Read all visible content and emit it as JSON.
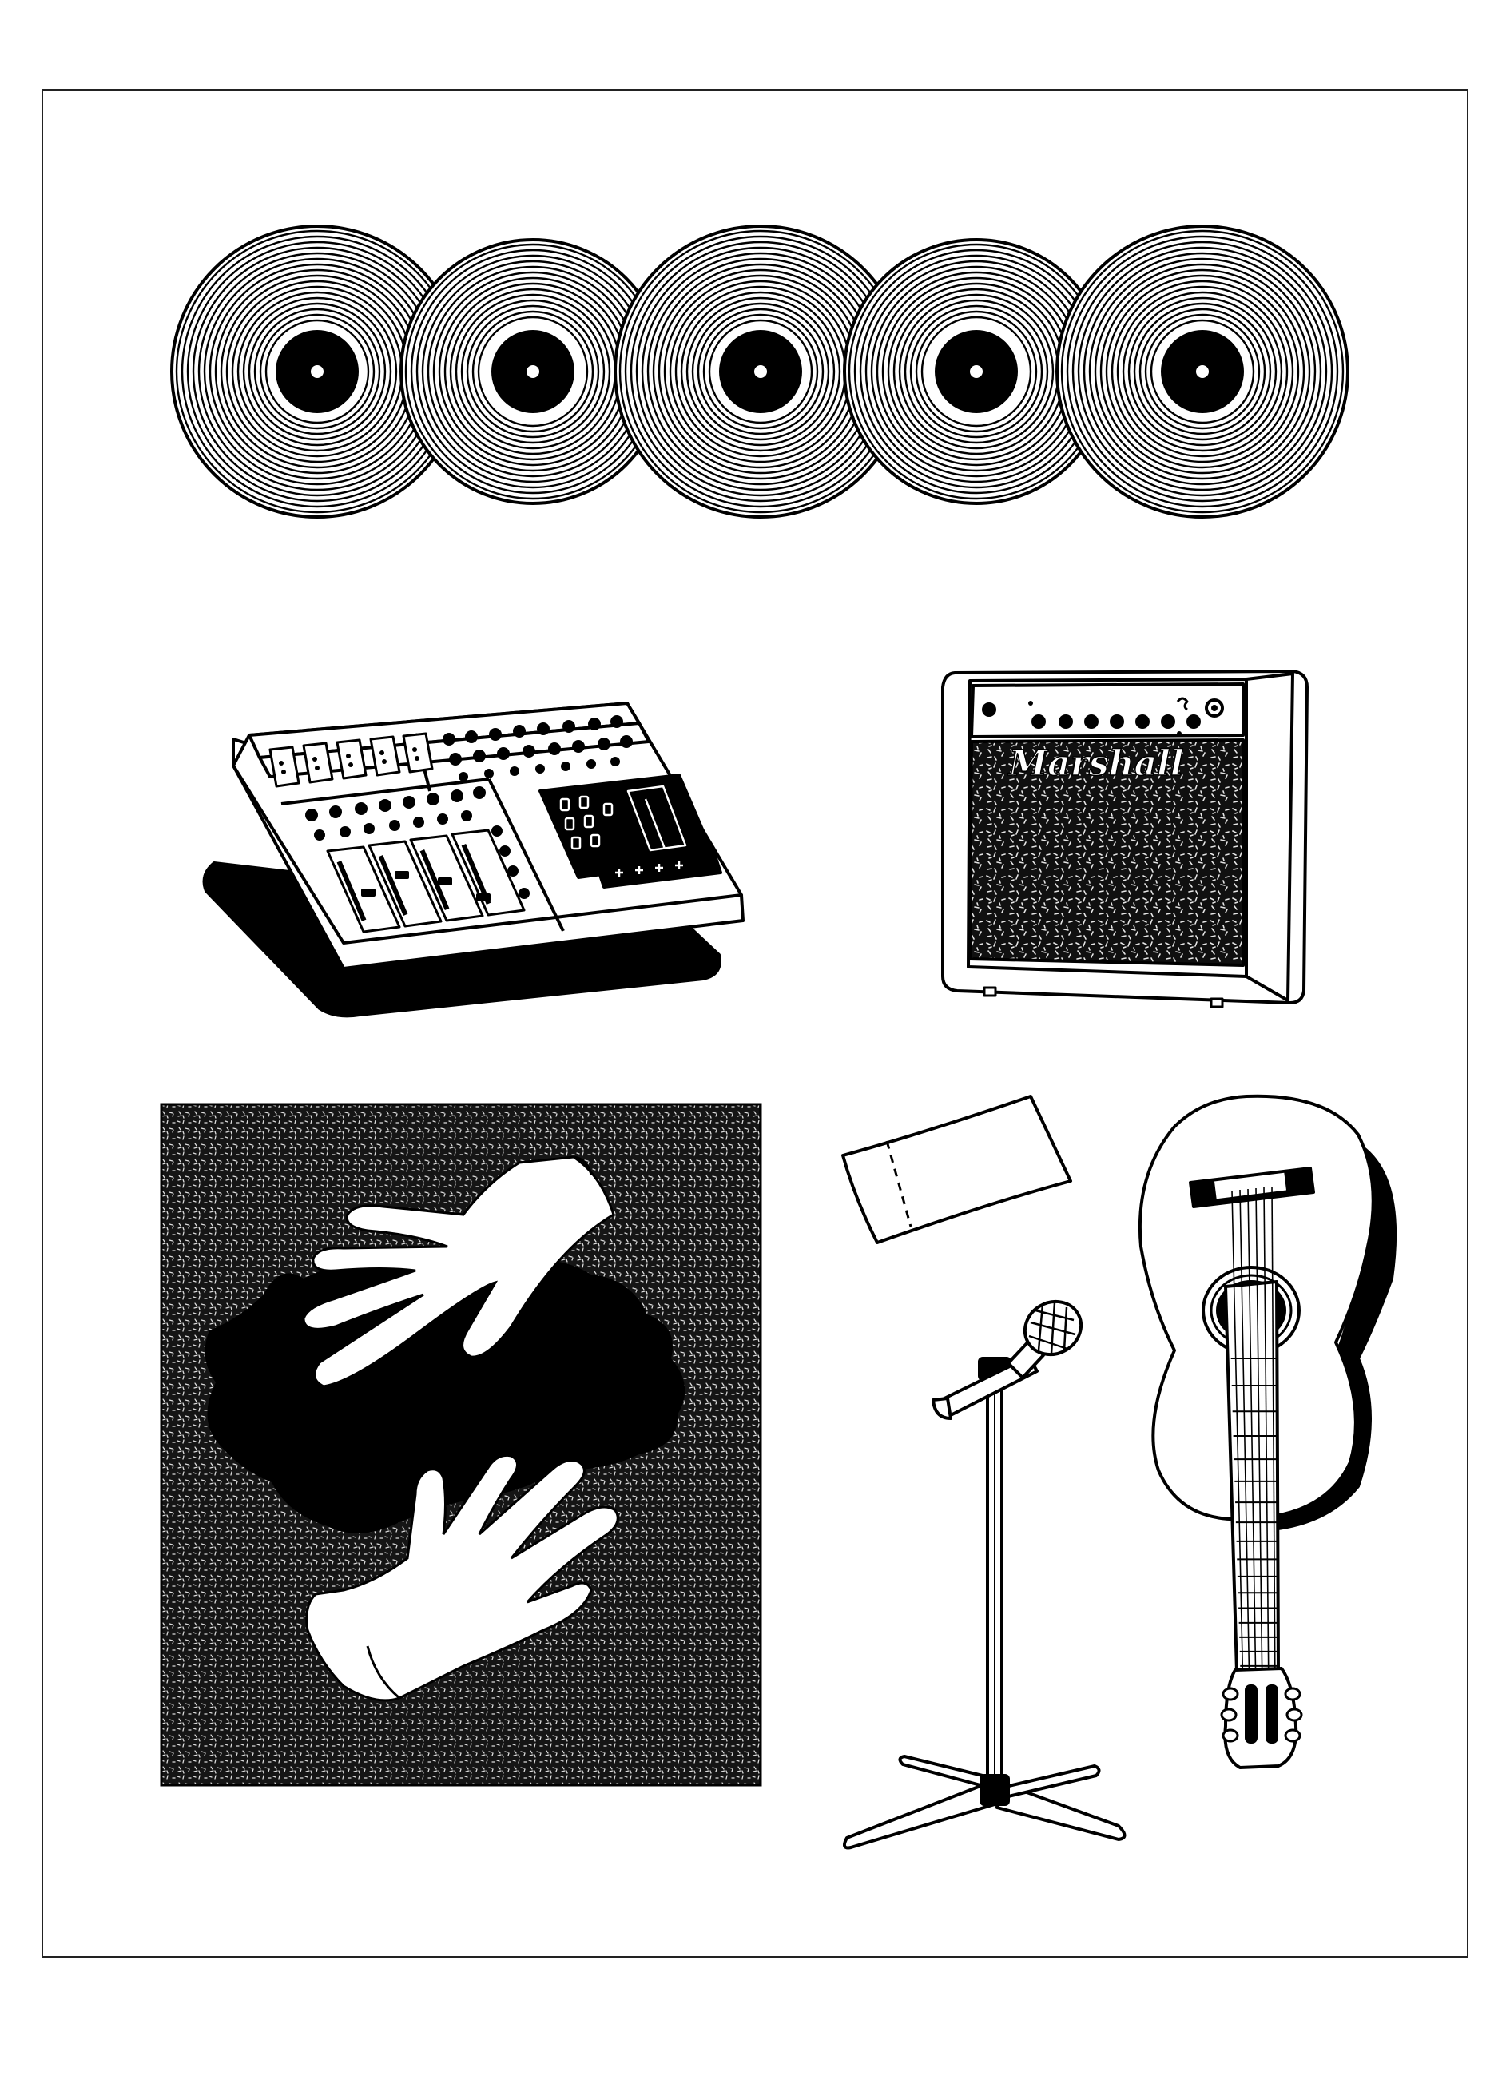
{
  "colors": {
    "ink": "#000000",
    "paper": "#ffffff",
    "frame": "#222222"
  },
  "records": {
    "count": 5
  },
  "amplifier": {
    "brand_logo": "Marshall"
  },
  "illustrations": [
    "vinyl-records-icon",
    "mixing-console-icon",
    "guitar-amplifier-icon",
    "album-cover-hands-icon",
    "ticket-icon",
    "microphone-stand-icon",
    "acoustic-guitar-icon"
  ]
}
